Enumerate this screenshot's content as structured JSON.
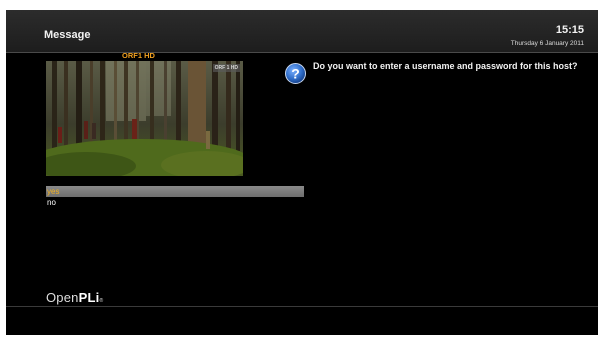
{
  "header": {
    "title": "Message",
    "time": "15:15",
    "date": "Thursday 6 January 2011"
  },
  "preview": {
    "channel_name": "ORF1 HD",
    "channel_logo": "ORF 1 HD"
  },
  "dialog": {
    "icon": "question-icon",
    "question": "Do you want to enter a username and password for this host?",
    "choices": [
      "yes",
      "no"
    ],
    "selected_index": 0
  },
  "brand": {
    "part1": "Open",
    "part2": "PLi",
    "suffix": "®"
  },
  "colors": {
    "accent": "#f0a020",
    "selection_bar": "#7a7a7a",
    "background": "#000000",
    "header": "#262626",
    "icon_blue": "#2e6cc8"
  }
}
